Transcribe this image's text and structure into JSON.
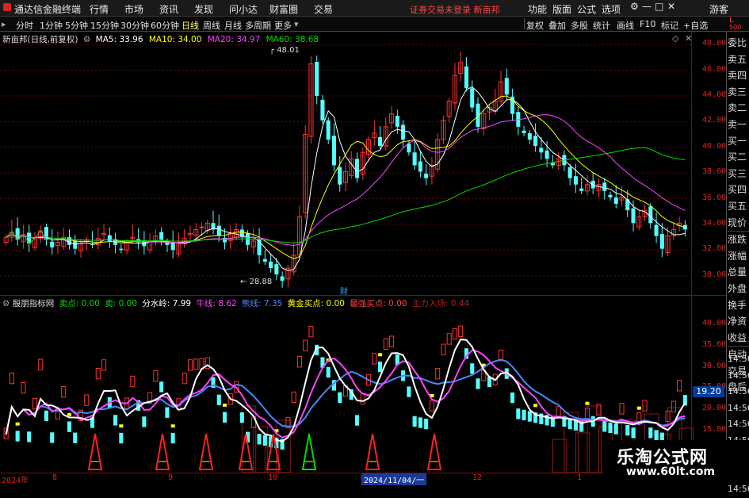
{
  "menu": {
    "app_title": "通达信金融终端",
    "items": [
      "行情",
      "市场",
      "资讯",
      "发现",
      "问小达",
      "财富圈",
      "交易"
    ],
    "notice": "证券交易未登录  新亩邦",
    "right_items": [
      "功能",
      "版面",
      "公式",
      "选项"
    ],
    "guest": "游客"
  },
  "toolbar": {
    "periods": [
      "分时",
      "1分钟",
      "5分钟",
      "15分钟",
      "30分钟",
      "60分钟",
      "日线",
      "周线",
      "月线",
      "多周期",
      "更多"
    ],
    "active": "日线",
    "right": [
      "复权",
      "叠加",
      "多股",
      "统计",
      "画线",
      "F10",
      "标记",
      "+自选"
    ]
  },
  "legend_main": {
    "name": "新亩邦(日线,前复权)",
    "ma5": "MA5: 33.96",
    "ma10": "MA10: 34.00",
    "ma20": "MA20: 34.97",
    "ma60": "MA60: 38.68"
  },
  "legend_sub": {
    "name": "殷朋指标网",
    "sell": "卖点: 0.00",
    "sell2": "卖: 0.00",
    "water": "分水岭: 7.99",
    "bull": "牛线: 8.62",
    "bear": "熊线: 7.35",
    "gold": "黄金买点: 0.00",
    "strong": "最强买点: 0.00",
    "main": "主力入场: 0.44"
  },
  "corner": {
    "L": "L",
    "num": "500"
  },
  "side_labels": [
    "委比",
    "卖五",
    "卖四",
    "卖三",
    "卖二",
    "卖一",
    "买一",
    "买二",
    "买三",
    "买四",
    "买五",
    "现价",
    "涨跌",
    "涨幅",
    "总量",
    "外盘",
    "换手",
    "净资",
    "收益",
    "自动",
    "交易",
    "盘后"
  ],
  "side_right": [
    "14:56",
    "14:56",
    "14:56",
    "14:56",
    "14:56",
    "14:56",
    "14:56",
    "14:56",
    "14:56"
  ],
  "price_highlight": "19.20",
  "annot": {
    "high": "48.01",
    "low": "28.88",
    "event": "财"
  },
  "watermark": {
    "line1": "乐淘公式网",
    "line2": "www.60lt.com"
  },
  "colors": {
    "up": "#ff3333",
    "down": "#54ffff",
    "ma5": "#ffffff",
    "ma10": "#ffff00",
    "ma20": "#ff44ff",
    "ma60": "#00dd00"
  },
  "chart_data": [
    {
      "type": "candlestick",
      "title": "新亩邦(日线,前复权)",
      "y_ticks": [
        48.0,
        46.0,
        44.0,
        42.0,
        40.0,
        38.0,
        36.0,
        34.0,
        32.0,
        30.0
      ],
      "ylim": [
        28.5,
        49.0
      ],
      "x_labels": [
        "2024年",
        "8",
        "9",
        "10",
        "2024/11/04/一",
        "12",
        "1"
      ],
      "series_close": [
        33.0,
        33.4,
        32.8,
        33.2,
        32.5,
        32.9,
        33.5,
        32.8,
        32.2,
        32.6,
        33.0,
        32.4,
        32.1,
        32.5,
        32.8,
        32.4,
        32.9,
        33.3,
        32.7,
        32.4,
        32.0,
        32.6,
        33.0,
        32.6,
        32.3,
        32.7,
        33.1,
        32.8,
        32.4,
        32.0,
        32.5,
        32.9,
        33.3,
        33.6,
        33.8,
        34.1,
        33.6,
        33.1,
        32.6,
        33.3,
        33.6,
        33.0,
        32.4,
        32.7,
        31.6,
        31.1,
        30.6,
        30.1,
        29.6,
        30.6,
        31.6,
        34.6,
        41.0,
        46.5,
        44.0,
        42.1,
        40.6,
        38.6,
        37.1,
        38.1,
        39.1,
        37.6,
        39.6,
        40.6,
        41.1,
        40.1,
        41.6,
        42.6,
        41.6,
        40.6,
        39.6,
        38.6,
        38.1,
        37.6,
        38.6,
        40.6,
        42.1,
        43.6,
        45.6,
        46.6,
        44.6,
        43.1,
        41.6,
        42.6,
        43.1,
        43.6,
        45.1,
        44.1,
        42.6,
        41.6,
        41.1,
        40.6,
        40.1,
        39.6,
        39.1,
        38.6,
        39.1,
        38.6,
        37.6,
        37.1,
        36.6,
        37.1,
        36.8,
        37.1,
        36.6,
        36.1,
        35.6,
        36.1,
        35.1,
        34.1,
        34.6,
        35.1,
        34.1,
        33.1,
        32.1,
        33.1,
        33.6,
        34.1,
        33.6
      ],
      "series": [
        {
          "name": "MA5",
          "value": 33.96
        },
        {
          "name": "MA10",
          "value": 34.0
        },
        {
          "name": "MA20",
          "value": 34.97
        },
        {
          "name": "MA60",
          "value": 38.68
        }
      ]
    },
    {
      "type": "indicator",
      "title": "殷朋指标网",
      "y_ticks": [
        40.0,
        35.0,
        30.0,
        25.0,
        20.0,
        15.0
      ],
      "ylim": [
        5,
        44
      ],
      "series": [
        {
          "name": "牛线",
          "value": 8.62
        },
        {
          "name": "熊线",
          "value": 7.35
        },
        {
          "name": "分水岭",
          "value": 7.99
        }
      ]
    }
  ]
}
